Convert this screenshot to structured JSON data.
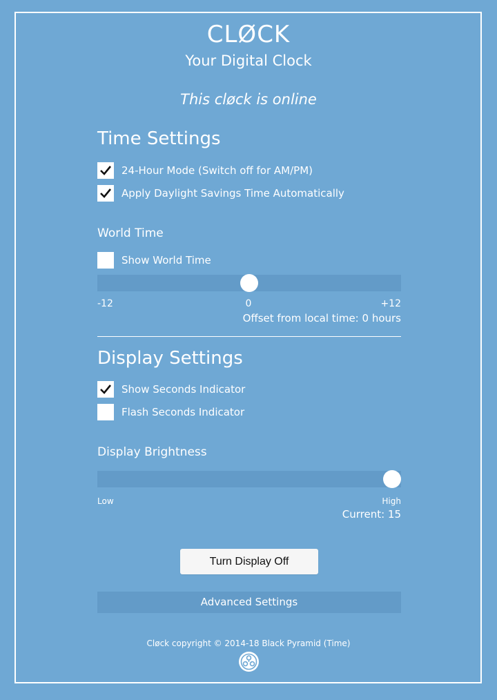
{
  "header": {
    "title": "CLØCK",
    "subtitle": "Your Digital Clock",
    "status": "This cløck is online"
  },
  "time_settings": {
    "title": "Time Settings",
    "options": [
      {
        "label": "24-Hour Mode (Switch off for AM/PM)",
        "checked": true
      },
      {
        "label": "Apply Daylight Savings Time Automatically",
        "checked": true
      }
    ]
  },
  "world_time": {
    "title": "World Time",
    "show_label": "Show World Time",
    "show_checked": false,
    "slider": {
      "min_label": "-12",
      "mid_label": "0",
      "max_label": "+12",
      "min": -12,
      "max": 12,
      "value": 0
    },
    "offset_text": "Offset from local time: 0 hours"
  },
  "display_settings": {
    "title": "Display Settings",
    "options": [
      {
        "label": "Show Seconds Indicator",
        "checked": true
      },
      {
        "label": "Flash Seconds Indicator",
        "checked": false
      }
    ]
  },
  "brightness": {
    "title": "Display Brightness",
    "slider": {
      "min_label": "Low",
      "max_label": "High",
      "min": 0,
      "max": 15,
      "value": 15
    },
    "current_text": "Current: 15"
  },
  "actions": {
    "turn_off_label": "Turn Display Off",
    "advanced_label": "Advanced Settings"
  },
  "footer": {
    "copyright": "Cløck copyright © 2014-18 Black Pyramid (Time)",
    "logo_icon": "black-pyramid-logo-icon"
  },
  "colors": {
    "background": "#6fa8d4",
    "track": "#639bc8",
    "text": "#ffffff"
  }
}
